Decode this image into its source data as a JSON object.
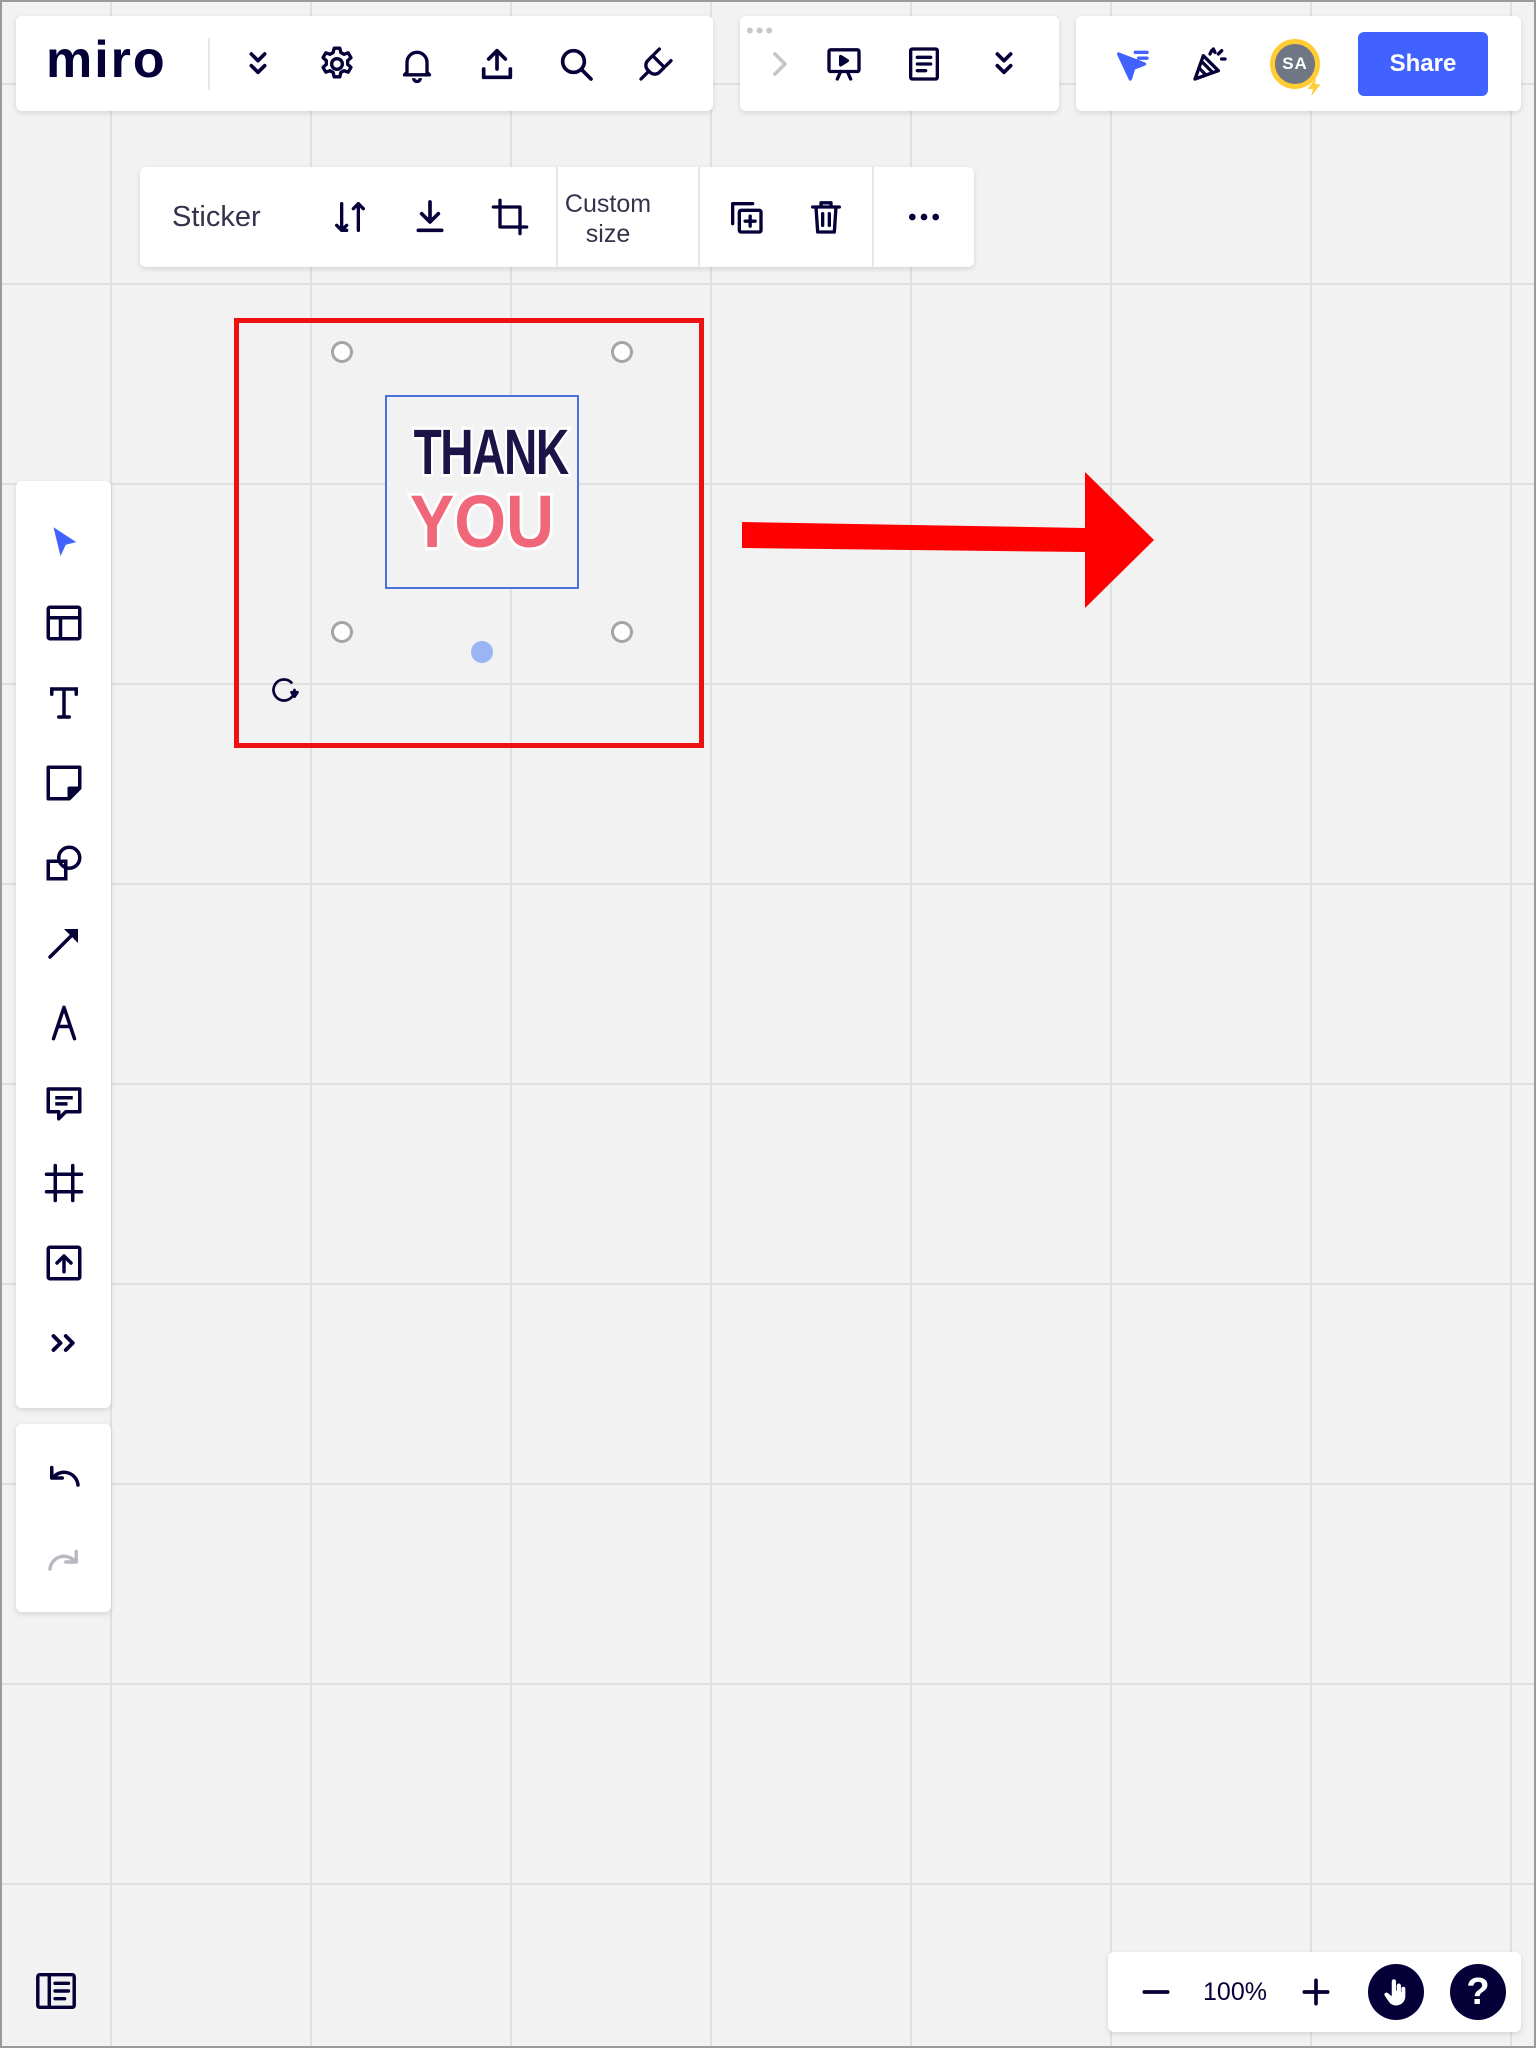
{
  "topbar": {
    "logo": "miro"
  },
  "context_toolbar": {
    "label": "Sticker",
    "custom_size": "Custom size"
  },
  "collab": {
    "avatar_initials": "SA",
    "share_label": "Share"
  },
  "canvas": {
    "sticker_line1": "THANK",
    "sticker_line2": "YOU"
  },
  "zoom": {
    "level": "100%"
  },
  "help": {
    "label": "?"
  },
  "colors": {
    "accent": "#4262ff",
    "annotation_red": "#ee1111",
    "text_dark": "#050038",
    "avatar_ring": "#ffcc33"
  },
  "icons": [
    "chevrons-down-icon",
    "gear-icon",
    "bell-icon",
    "upload-icon",
    "search-icon",
    "plug-icon",
    "chevron-right-icon",
    "presentation-icon",
    "notes-icon",
    "cursor-arrow-icon",
    "party-popper-icon",
    "swap-icon",
    "download-icon",
    "crop-icon",
    "duplicate-icon",
    "trash-icon",
    "more-icon",
    "select-icon",
    "templates-icon",
    "text-icon",
    "sticky-note-icon",
    "shapes-icon",
    "arrow-icon",
    "pen-icon",
    "comment-icon",
    "frame-icon",
    "upload-file-icon",
    "more-tools-icon",
    "undo-icon",
    "redo-icon",
    "sidebar-icon",
    "zoom-out-icon",
    "zoom-in-icon",
    "hand-icon",
    "help-icon",
    "rotate-icon"
  ]
}
